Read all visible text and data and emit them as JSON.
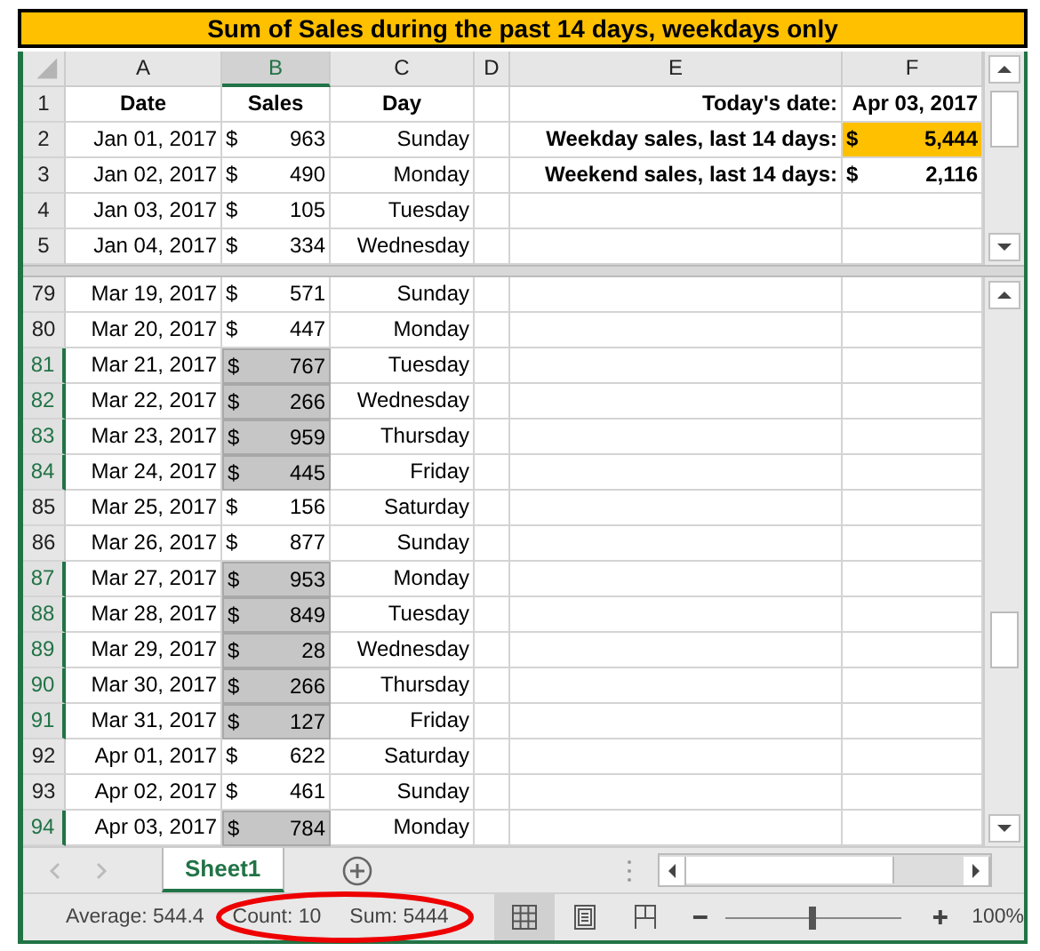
{
  "title": "Sum of Sales during the past 14 days, weekdays only",
  "columns": [
    {
      "label": "A",
      "selected": false
    },
    {
      "label": "B",
      "selected": true
    },
    {
      "label": "C",
      "selected": false
    },
    {
      "label": "D",
      "selected": false
    },
    {
      "label": "E",
      "selected": false
    },
    {
      "label": "F",
      "selected": false
    }
  ],
  "top_pane": {
    "rows": [
      {
        "number": "1",
        "kind": "header",
        "selected": false,
        "date": "Date",
        "sales": "Sales",
        "day": "Day",
        "label": "Today's date:",
        "value": "Apr 03, 2017"
      },
      {
        "number": "2",
        "kind": "data",
        "selected": false,
        "date": "Jan 01, 2017",
        "currency": "$",
        "sales": "963",
        "day": "Sunday",
        "label": "Weekday sales, last 14 days:",
        "value_currency": "$",
        "value": "5,444",
        "highlighted": true
      },
      {
        "number": "3",
        "kind": "data",
        "selected": false,
        "date": "Jan 02, 2017",
        "currency": "$",
        "sales": "490",
        "day": "Monday",
        "label": "Weekend sales, last 14 days:",
        "value_currency": "$",
        "value": "2,116",
        "highlighted": false
      },
      {
        "number": "4",
        "kind": "data",
        "selected": false,
        "date": "Jan 03, 2017",
        "currency": "$",
        "sales": "105",
        "day": "Tuesday"
      },
      {
        "number": "5",
        "kind": "data",
        "selected": false,
        "date": "Jan 04, 2017",
        "currency": "$",
        "sales": "334",
        "day": "Wednesday"
      }
    ]
  },
  "bottom_pane": {
    "rows": [
      {
        "number": "79",
        "kind": "data",
        "selected": false,
        "date": "Mar 19, 2017",
        "currency": "$",
        "sales": "571",
        "day": "Sunday"
      },
      {
        "number": "80",
        "kind": "data",
        "selected": false,
        "date": "Mar 20, 2017",
        "currency": "$",
        "sales": "447",
        "day": "Monday"
      },
      {
        "number": "81",
        "kind": "data",
        "selected": true,
        "date": "Mar 21, 2017",
        "currency": "$",
        "sales": "767",
        "day": "Tuesday"
      },
      {
        "number": "82",
        "kind": "data",
        "selected": true,
        "date": "Mar 22, 2017",
        "currency": "$",
        "sales": "266",
        "day": "Wednesday"
      },
      {
        "number": "83",
        "kind": "data",
        "selected": true,
        "date": "Mar 23, 2017",
        "currency": "$",
        "sales": "959",
        "day": "Thursday"
      },
      {
        "number": "84",
        "kind": "data",
        "selected": true,
        "date": "Mar 24, 2017",
        "currency": "$",
        "sales": "445",
        "day": "Friday"
      },
      {
        "number": "85",
        "kind": "data",
        "selected": false,
        "date": "Mar 25, 2017",
        "currency": "$",
        "sales": "156",
        "day": "Saturday"
      },
      {
        "number": "86",
        "kind": "data",
        "selected": false,
        "date": "Mar 26, 2017",
        "currency": "$",
        "sales": "877",
        "day": "Sunday"
      },
      {
        "number": "87",
        "kind": "data",
        "selected": true,
        "date": "Mar 27, 2017",
        "currency": "$",
        "sales": "953",
        "day": "Monday"
      },
      {
        "number": "88",
        "kind": "data",
        "selected": true,
        "date": "Mar 28, 2017",
        "currency": "$",
        "sales": "849",
        "day": "Tuesday"
      },
      {
        "number": "89",
        "kind": "data",
        "selected": true,
        "date": "Mar 29, 2017",
        "currency": "$",
        "sales": "28",
        "day": "Wednesday"
      },
      {
        "number": "90",
        "kind": "data",
        "selected": true,
        "date": "Mar 30, 2017",
        "currency": "$",
        "sales": "266",
        "day": "Thursday"
      },
      {
        "number": "91",
        "kind": "data",
        "selected": true,
        "date": "Mar 31, 2017",
        "currency": "$",
        "sales": "127",
        "day": "Friday"
      },
      {
        "number": "92",
        "kind": "data",
        "selected": false,
        "date": "Apr 01, 2017",
        "currency": "$",
        "sales": "622",
        "day": "Saturday"
      },
      {
        "number": "93",
        "kind": "data",
        "selected": false,
        "date": "Apr 02, 2017",
        "currency": "$",
        "sales": "461",
        "day": "Sunday"
      },
      {
        "number": "94",
        "kind": "data",
        "selected": true,
        "date": "Apr 03, 2017",
        "currency": "$",
        "sales": "784",
        "day": "Monday"
      }
    ]
  },
  "sheet_tabs": [
    {
      "label": "Sheet1",
      "selected": true
    }
  ],
  "status_bar": {
    "average": "Average: 544.4",
    "count": "Count: 10",
    "sum": "Sum: 5444",
    "views": [
      {
        "kind": "normal",
        "selected": true
      },
      {
        "kind": "page_layout",
        "selected": false
      },
      {
        "kind": "page_break",
        "selected": false
      }
    ],
    "zoom": {
      "level": 0.5,
      "reading": "100%"
    }
  }
}
